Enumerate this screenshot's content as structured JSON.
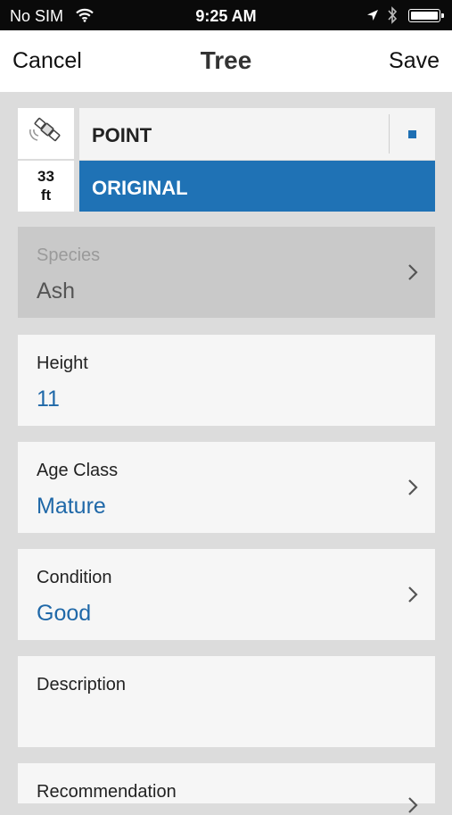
{
  "status_bar": {
    "carrier": "No SIM",
    "time": "9:25 AM",
    "icons": [
      "wifi-icon",
      "location-arrow-icon",
      "bluetooth-icon",
      "battery-icon"
    ]
  },
  "nav": {
    "cancel": "Cancel",
    "title": "Tree",
    "save": "Save"
  },
  "gps": {
    "icon": "satellite-icon",
    "accuracy_value": "33",
    "accuracy_unit": "ft",
    "geometry": "POINT",
    "source": "ORIGINAL"
  },
  "fields": [
    {
      "label": "Species",
      "value": "Ash",
      "disabled": true,
      "chevron": true
    },
    {
      "label": "Height",
      "value": "11",
      "disabled": false,
      "chevron": false
    },
    {
      "label": "Age Class",
      "value": "Mature",
      "disabled": false,
      "chevron": true
    },
    {
      "label": "Condition",
      "value": "Good",
      "disabled": false,
      "chevron": true
    },
    {
      "label": "Description",
      "value": "",
      "disabled": false,
      "chevron": false
    },
    {
      "label": "Recommendation",
      "value": "",
      "disabled": false,
      "chevron": true
    }
  ],
  "colors": {
    "accent": "#1f72b5",
    "value_text": "#1f68a8",
    "status_bar": "#0a0a0a",
    "background": "#dcdcdc"
  }
}
